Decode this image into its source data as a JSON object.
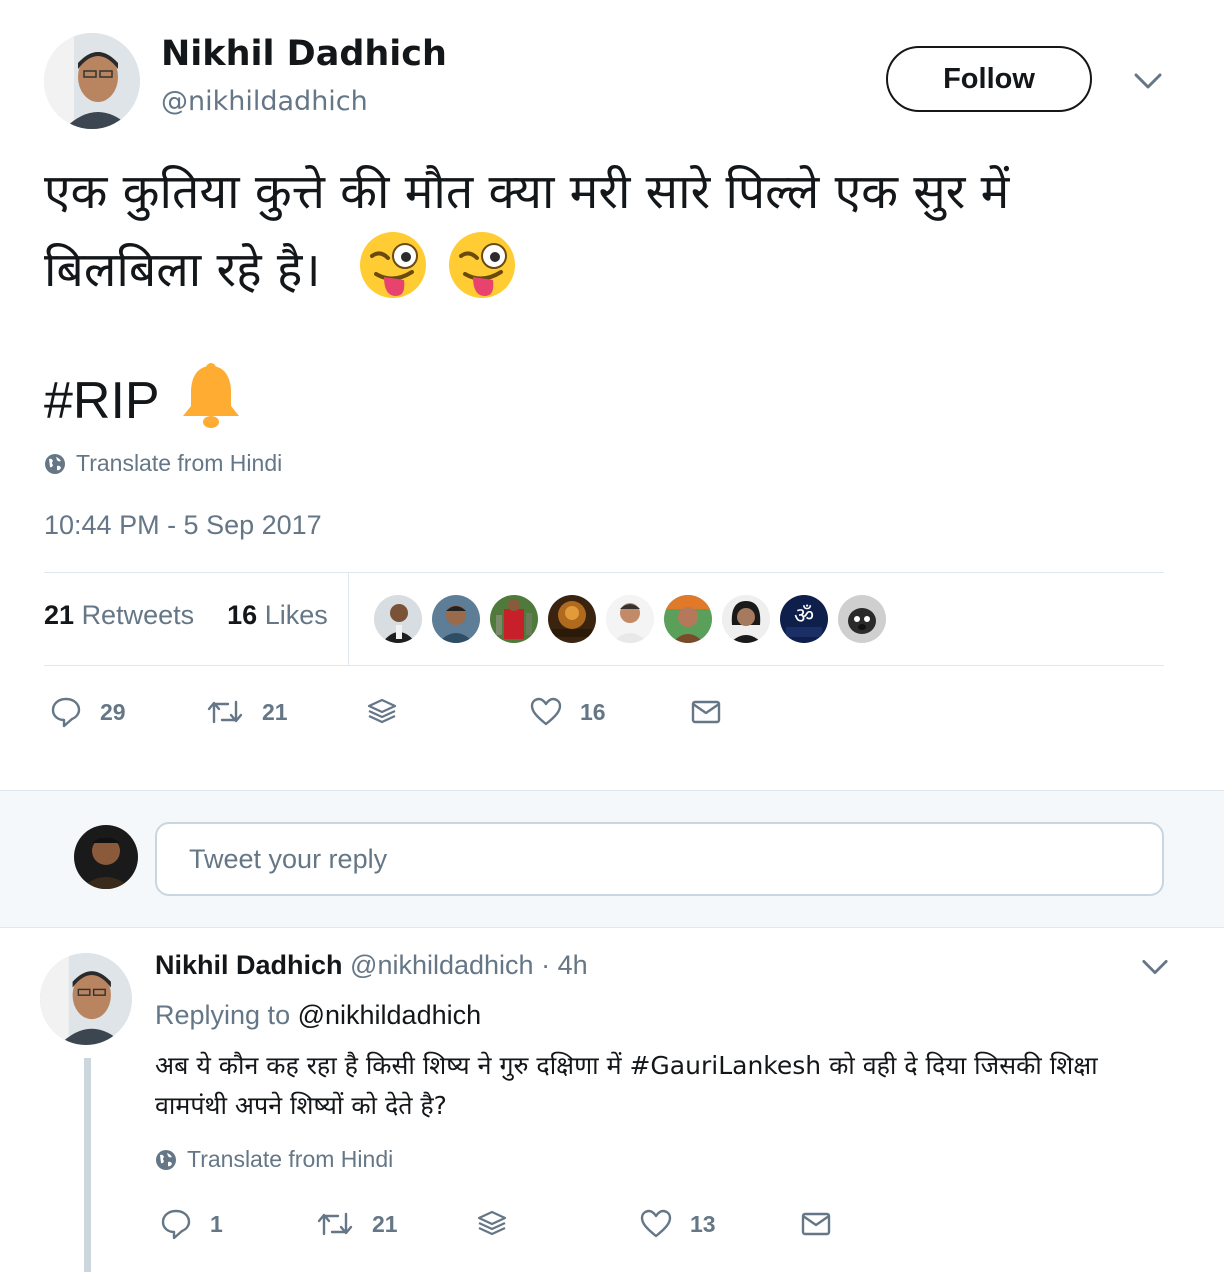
{
  "tweet": {
    "author_name": "Nikhil Dadhich",
    "author_handle": "@nikhildadhich",
    "follow_label": "Follow",
    "text_line1": "एक कुतिया कुत्ते की मौत क्या मरी सारे पिल्ले एक सुर में",
    "text_line2": "बिलबिला रहे है।",
    "text_line3": "#RIP",
    "emojis": [
      "winking-face-with-tongue",
      "winking-face-with-tongue",
      "bell"
    ],
    "translate_label": "Translate from Hindi",
    "timestamp": "10:44 PM - 5 Sep 2017",
    "retweets_count": "21",
    "retweets_label": "Retweets",
    "likes_count": "16",
    "likes_label": "Likes",
    "liker_avatars": 9,
    "actions": {
      "reply_count": "29",
      "retweet_count": "21",
      "like_count": "16"
    }
  },
  "reply_box": {
    "placeholder": "Tweet your reply"
  },
  "reply": {
    "author_name": "Nikhil Dadhich",
    "author_handle": "@nikhildadhich",
    "separator": "·",
    "time": "4h",
    "replying_prefix": "Replying to",
    "replying_to": "@nikhildadhich",
    "text_line1": "अब ये कौन कह रहा है किसी शिष्य ने गुरु दक्षिणा में #GauriLankesh को वही दे दिया जिसकी शिक्षा",
    "text_line2": "वामपंथी अपने शिष्यों को देते है?",
    "translate_label": "Translate from Hindi",
    "actions": {
      "reply_count": "1",
      "retweet_count": "21",
      "like_count": "13"
    }
  },
  "colors": {
    "text": "#14171a",
    "muted": "#657786",
    "border": "#e1e8ed",
    "reply_bg": "#f5f8fa"
  }
}
